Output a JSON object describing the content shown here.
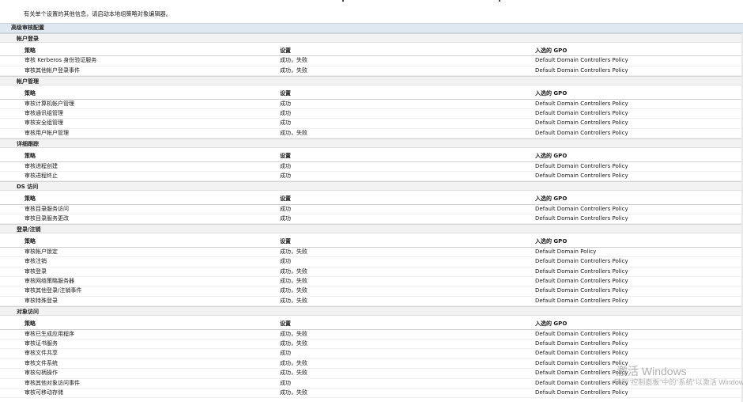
{
  "note": "有关单个设置的其他信息，请启动本地组策略对象编辑器。",
  "main_header": "高级审核配置",
  "columns": {
    "policy": "策略",
    "setting": "设置",
    "gpo": "入选的 GPO"
  },
  "sections": [
    {
      "title": "帐户登录",
      "rows": [
        [
          "审核 Kerberos 身份验证服务",
          "成功，失败",
          "Default Domain Controllers Policy"
        ],
        [
          "审核其他帐户登录事件",
          "成功，失败",
          "Default Domain Controllers Policy"
        ]
      ]
    },
    {
      "title": "帐户管理",
      "rows": [
        [
          "审核计算机帐户管理",
          "成功",
          "Default Domain Controllers Policy"
        ],
        [
          "审核通讯组管理",
          "成功",
          "Default Domain Controllers Policy"
        ],
        [
          "审核安全组管理",
          "成功",
          "Default Domain Controllers Policy"
        ],
        [
          "审核用户帐户管理",
          "成功，失败",
          "Default Domain Controllers Policy"
        ]
      ]
    },
    {
      "title": "详细跟踪",
      "rows": [
        [
          "审核进程创建",
          "成功",
          "Default Domain Controllers Policy"
        ],
        [
          "审核进程终止",
          "成功",
          "Default Domain Controllers Policy"
        ]
      ]
    },
    {
      "title": "DS 访问",
      "rows": [
        [
          "审核目录服务访问",
          "成功",
          "Default Domain Controllers Policy"
        ],
        [
          "审核目录服务更改",
          "成功",
          "Default Domain Controllers Policy"
        ]
      ]
    },
    {
      "title": "登录/注销",
      "rows": [
        [
          "审核帐户锁定",
          "成功，失败",
          "Default Domain Policy"
        ],
        [
          "审核注销",
          "成功",
          "Default Domain Controllers Policy"
        ],
        [
          "审核登录",
          "成功，失败",
          "Default Domain Controllers Policy"
        ],
        [
          "审核网络策略服务器",
          "成功，失败",
          "Default Domain Controllers Policy"
        ],
        [
          "审核其他登录/注销事件",
          "成功，失败",
          "Default Domain Controllers Policy"
        ],
        [
          "审核特殊登录",
          "成功，失败",
          "Default Domain Controllers Policy"
        ]
      ]
    },
    {
      "title": "对象访问",
      "rows": [
        [
          "审核已生成应用程序",
          "成功，失败",
          "Default Domain Controllers Policy"
        ],
        [
          "审核证书服务",
          "成功，失败",
          "Default Domain Controllers Policy"
        ],
        [
          "审核文件共享",
          "成功",
          "Default Domain Controllers Policy"
        ],
        [
          "审核文件系统",
          "成功，失败",
          "Default Domain Controllers Policy"
        ],
        [
          "审核句柄操作",
          "成功，失败",
          "Default Domain Controllers Policy"
        ],
        [
          "审核其他对象访问事件",
          "成功",
          "Default Domain Controllers Policy"
        ],
        [
          "审核可移动存储",
          "成功，失败",
          "Default Domain Controllers Policy"
        ]
      ]
    }
  ],
  "watermark": {
    "line1": "激活 Windows",
    "line2": "转到\"控制面板\"中的\"系统\"以激活 Windows"
  }
}
